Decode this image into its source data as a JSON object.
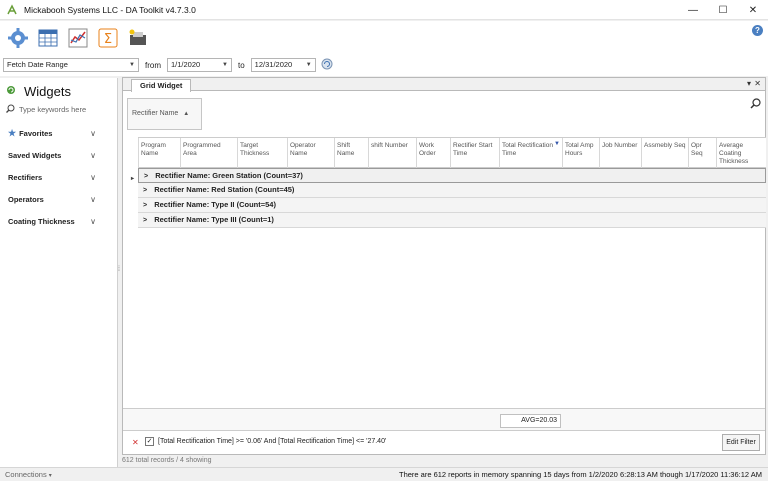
{
  "window": {
    "title": "Mickabooh Systems LLC - DA Toolkit v4.7.3.0",
    "minimize": "—",
    "maximize": "☐",
    "close": "✕"
  },
  "toolbar": {
    "icons": [
      "gear-icon",
      "grid-icon",
      "chart-icon",
      "sigma-icon",
      "export-icon"
    ],
    "help": "?"
  },
  "filter": {
    "range_select": "Fetch Date Range",
    "from_label": "from",
    "from_value": "1/1/2020",
    "to_label": "to",
    "to_value": "12/31/2020"
  },
  "sidebar": {
    "title": "Widgets",
    "search_placeholder": "Type keywords here",
    "items": [
      {
        "label": "Favorites"
      },
      {
        "label": "Saved Widgets"
      },
      {
        "label": "Rectifiers"
      },
      {
        "label": "Operators"
      },
      {
        "label": "Coating Thickness"
      }
    ]
  },
  "main": {
    "tab": "Grid Widget",
    "group_by": "Rectifier Name",
    "columns": [
      "Program Name",
      "Programmed Area",
      "Target Thickness",
      "Operator Name",
      "Shift Name",
      "shift Number",
      "Work Order",
      "Rectifier Start Time",
      "Total Rectification Time",
      "Total Amp Hours",
      "Job Number",
      "Assmebly Seq",
      "Opr Seq",
      "Average Coating Thickness"
    ],
    "groups": [
      "Rectifier Name: Green Station (Count=37)",
      "Rectifier Name: Red Station (Count=45)",
      "Rectifier Name: Type II (Count=54)",
      "Rectifier Name: Type III (Count=1)"
    ],
    "avg": "AVG=20.03",
    "filter_expr": "[Total Rectification Time] >= '0.06' And [Total Rectification Time] <= '27.40'",
    "edit_filter": "Edit Filter"
  },
  "records": "612 total records / 4 showing",
  "status": {
    "connections": "Connections",
    "message": "There are 612 reports in memory spanning 15 days from 1/2/2020 6:28:13 AM though 1/17/2020 11:36:12 AM"
  },
  "colors": {
    "accent": "#4a7fc1",
    "gear": "#5b8fd1",
    "sigma": "#e8811a"
  }
}
